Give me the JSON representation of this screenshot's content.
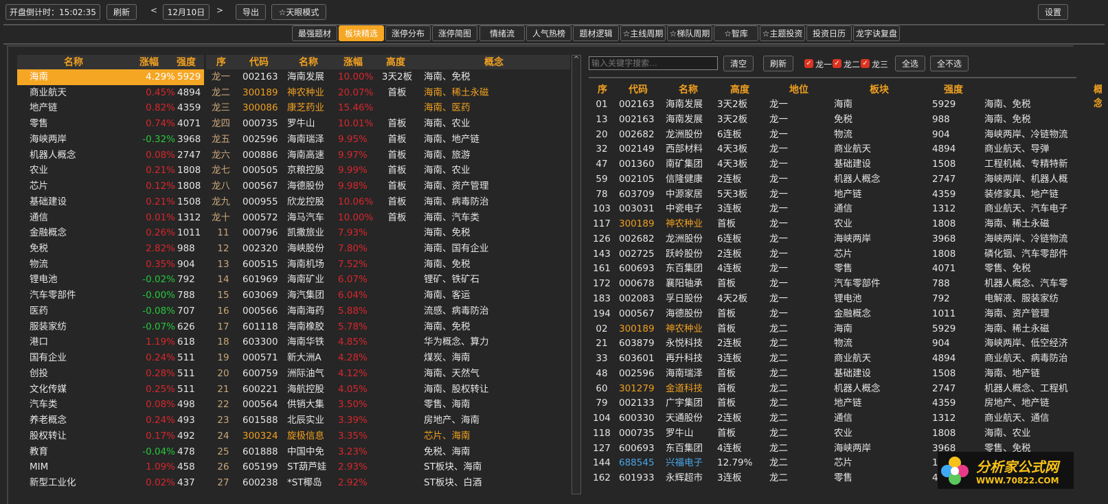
{
  "toolbar": {
    "countdown": "开盘倒计时：15:02:35",
    "refresh": "刷新",
    "prev": "<",
    "date": "12月10日",
    "next": ">",
    "export": "导出",
    "tianyan": "☆天眼模式",
    "settings": "设置"
  },
  "tabs": [
    "最强题材",
    "板块精选",
    "涨停分布",
    "涨停简图",
    "情绪流",
    "人气热榜",
    "题材逻辑",
    "☆主线周期",
    "☆梯队周期",
    "☆智库",
    "☆主题投资",
    "投资日历",
    "龙字诀复盘"
  ],
  "active_tab": "板块精选",
  "left_table": {
    "headers": [
      "名称",
      "涨幅",
      "强度"
    ],
    "rows": [
      [
        "海南",
        "4.29%",
        "5929"
      ],
      [
        "商业航天",
        "0.45%",
        "4894"
      ],
      [
        "地产链",
        "0.82%",
        "4359"
      ],
      [
        "零售",
        "0.74%",
        "4071"
      ],
      [
        "海峡两岸",
        "-0.32%",
        "3968"
      ],
      [
        "机器人概念",
        "0.08%",
        "2747"
      ],
      [
        "农业",
        "0.21%",
        "1808"
      ],
      [
        "芯片",
        "0.12%",
        "1808"
      ],
      [
        "基础建设",
        "0.21%",
        "1508"
      ],
      [
        "通信",
        "0.01%",
        "1312"
      ],
      [
        "金融概念",
        "0.26%",
        "1011"
      ],
      [
        "免税",
        "2.82%",
        "988"
      ],
      [
        "物流",
        "0.35%",
        "904"
      ],
      [
        "锂电池",
        "-0.02%",
        "792"
      ],
      [
        "汽车零部件",
        "-0.00%",
        "788"
      ],
      [
        "医药",
        "-0.08%",
        "707"
      ],
      [
        "服装家纺",
        "-0.07%",
        "626"
      ],
      [
        "港口",
        "1.19%",
        "618"
      ],
      [
        "国有企业",
        "0.24%",
        "511"
      ],
      [
        "创投",
        "0.28%",
        "511"
      ],
      [
        "文化传媒",
        "0.25%",
        "511"
      ],
      [
        "汽车类",
        "0.08%",
        "498"
      ],
      [
        "养老概念",
        "0.24%",
        "493"
      ],
      [
        "股权转让",
        "0.17%",
        "492"
      ],
      [
        "教育",
        "-0.04%",
        "478"
      ],
      [
        "MIM",
        "1.09%",
        "458"
      ],
      [
        "新型工业化",
        "0.02%",
        "437"
      ]
    ]
  },
  "mid_table": {
    "headers": [
      "序",
      "代码",
      "名称",
      "涨幅",
      "高度",
      "概念"
    ],
    "rows": [
      [
        "龙一",
        "002163",
        "海南发展",
        "10.00%",
        "3天2板",
        "海南、免税",
        0
      ],
      [
        "龙二",
        "300189",
        "神农种业",
        "20.07%",
        "首板",
        "海南、稀土永磁",
        1
      ],
      [
        "龙三",
        "300086",
        "康芝药业",
        "15.46%",
        "",
        "海南、医药",
        1
      ],
      [
        "龙四",
        "000735",
        "罗牛山",
        "10.01%",
        "首板",
        "海南、农业",
        0
      ],
      [
        "龙五",
        "002596",
        "海南瑞泽",
        "9.95%",
        "首板",
        "海南、地产链",
        0
      ],
      [
        "龙六",
        "000886",
        "海南高速",
        "9.97%",
        "首板",
        "海南、旅游",
        0
      ],
      [
        "龙七",
        "000505",
        "京粮控股",
        "9.99%",
        "首板",
        "海南、农业",
        0
      ],
      [
        "龙八",
        "000567",
        "海德股份",
        "9.98%",
        "首板",
        "海南、资产管理",
        0
      ],
      [
        "龙九",
        "000955",
        "欣龙控股",
        "10.06%",
        "首板",
        "海南、病毒防治",
        0
      ],
      [
        "龙十",
        "000572",
        "海马汽车",
        "10.00%",
        "首板",
        "海南、汽车类",
        0
      ],
      [
        "11",
        "000796",
        "凯撒旅业",
        "7.93%",
        "",
        "海南、免税",
        0
      ],
      [
        "12",
        "002320",
        "海峡股份",
        "7.80%",
        "",
        "海南、国有企业",
        0
      ],
      [
        "13",
        "600515",
        "海南机场",
        "7.52%",
        "",
        "海南、免税",
        0
      ],
      [
        "14",
        "601969",
        "海南矿业",
        "6.07%",
        "",
        "锂矿、铁矿石",
        0
      ],
      [
        "15",
        "603069",
        "海汽集团",
        "6.04%",
        "",
        "海南、客运",
        0
      ],
      [
        "16",
        "000566",
        "海南海药",
        "5.88%",
        "",
        "流感、病毒防治",
        0
      ],
      [
        "17",
        "601118",
        "海南橡胶",
        "5.78%",
        "",
        "海南、免税",
        0
      ],
      [
        "18",
        "603300",
        "海南华铁",
        "4.85%",
        "",
        "华为概念、算力",
        0
      ],
      [
        "19",
        "000571",
        "新大洲A",
        "4.28%",
        "",
        "煤炭、海南",
        0
      ],
      [
        "20",
        "600759",
        "洲际油气",
        "4.12%",
        "",
        "海南、天然气",
        0
      ],
      [
        "21",
        "600221",
        "海航控股",
        "4.05%",
        "",
        "海南、股权转让",
        0
      ],
      [
        "22",
        "000564",
        "供销大集",
        "3.50%",
        "",
        "零售、海南",
        0
      ],
      [
        "23",
        "601588",
        "北辰实业",
        "3.39%",
        "",
        "房地产、海南",
        0
      ],
      [
        "24",
        "300324",
        "旋极信息",
        "3.35%",
        "",
        "芯片、海南",
        1
      ],
      [
        "25",
        "601888",
        "中国中免",
        "3.23%",
        "",
        "免税、海南",
        0
      ],
      [
        "26",
        "605199",
        "ST葫芦娃",
        "2.93%",
        "",
        "ST板块、海南",
        0
      ],
      [
        "27",
        "600238",
        "*ST椰岛",
        "2.92%",
        "",
        "ST板块、白酒",
        0
      ]
    ]
  },
  "right_panel": {
    "search_placeholder": "输入关键字搜索…",
    "clear": "清空",
    "refresh": "刷新",
    "filters": [
      "龙一",
      "龙二",
      "龙三"
    ],
    "select_all": "全选",
    "select_none": "全不选",
    "headers": [
      "序",
      "代码",
      "名称",
      "高度",
      "地位",
      "板块",
      "强度",
      "概念"
    ],
    "rows": [
      [
        "01",
        "002163",
        "海南发展",
        "3天2板",
        "龙一",
        "海南",
        "5929",
        "海南、免税",
        0
      ],
      [
        "13",
        "002163",
        "海南发展",
        "3天2板",
        "龙一",
        "免税",
        "988",
        "海南、免税",
        0
      ],
      [
        "20",
        "002682",
        "龙洲股份",
        "6连板",
        "龙一",
        "物流",
        "904",
        "海峡两岸、冷链物流",
        0
      ],
      [
        "32",
        "002149",
        "西部材料",
        "4天3板",
        "龙一",
        "商业航天",
        "4894",
        "商业航天、导弹",
        0
      ],
      [
        "47",
        "001360",
        "南矿集团",
        "4天3板",
        "龙一",
        "基础建设",
        "1508",
        "工程机械、专精特新",
        0
      ],
      [
        "59",
        "002105",
        "信隆健康",
        "2连板",
        "龙一",
        "机器人概念",
        "2747",
        "海峡两岸、机器人概",
        0
      ],
      [
        "78",
        "603709",
        "中源家居",
        "5天3板",
        "龙一",
        "地产链",
        "4359",
        "装修家具、地产链",
        0
      ],
      [
        "103",
        "003031",
        "中瓷电子",
        "3连板",
        "龙一",
        "通信",
        "1312",
        "商业航天、汽车电子",
        0
      ],
      [
        "117",
        "300189",
        "神农种业",
        "首板",
        "龙一",
        "农业",
        "1808",
        "海南、稀土永磁",
        1
      ],
      [
        "126",
        "002682",
        "龙洲股份",
        "6连板",
        "龙一",
        "海峡两岸",
        "3968",
        "海峡两岸、冷链物流",
        0
      ],
      [
        "143",
        "002725",
        "跃岭股份",
        "2连板",
        "龙一",
        "芯片",
        "1808",
        "磷化铟、汽车零部件",
        0
      ],
      [
        "161",
        "600693",
        "东百集团",
        "4连板",
        "龙一",
        "零售",
        "4071",
        "零售、免税",
        0
      ],
      [
        "172",
        "000678",
        "襄阳轴承",
        "首板",
        "龙一",
        "汽车零部件",
        "788",
        "机器人概念、汽车零",
        0
      ],
      [
        "183",
        "002083",
        "孚日股份",
        "4天2板",
        "龙一",
        "锂电池",
        "792",
        "电解液、服装家纺",
        0
      ],
      [
        "194",
        "000567",
        "海德股份",
        "首板",
        "龙一",
        "金融概念",
        "1011",
        "海南、资产管理",
        0
      ],
      [
        "02",
        "300189",
        "神农种业",
        "首板",
        "龙二",
        "海南",
        "5929",
        "海南、稀土永磁",
        1
      ],
      [
        "21",
        "603879",
        "永悦科技",
        "2连板",
        "龙二",
        "物流",
        "904",
        "海峡两岸、低空经济",
        0
      ],
      [
        "33",
        "603601",
        "再升科技",
        "3连板",
        "龙二",
        "商业航天",
        "4894",
        "商业航天、病毒防治",
        0
      ],
      [
        "48",
        "002596",
        "海南瑞泽",
        "首板",
        "龙二",
        "基础建设",
        "1508",
        "海南、地产链",
        0
      ],
      [
        "60",
        "301279",
        "金道科技",
        "首板",
        "龙二",
        "机器人概念",
        "2747",
        "机器人概念、工程机",
        1
      ],
      [
        "79",
        "002133",
        "广宇集团",
        "首板",
        "龙二",
        "地产链",
        "4359",
        "房地产、地产链",
        0
      ],
      [
        "104",
        "600330",
        "天通股份",
        "2连板",
        "龙二",
        "通信",
        "1312",
        "商业航天、通信",
        0
      ],
      [
        "118",
        "000735",
        "罗牛山",
        "首板",
        "龙二",
        "农业",
        "1808",
        "海南、农业",
        0
      ],
      [
        "127",
        "600693",
        "东百集团",
        "4连板",
        "龙二",
        "海峡两岸",
        "3968",
        "零售、免税",
        0
      ],
      [
        "144",
        "688545",
        "兴福电子",
        "12.79%",
        "龙二",
        "芯片",
        "1",
        "",
        2
      ],
      [
        "162",
        "601933",
        "永辉超市",
        "3连板",
        "龙二",
        "零售",
        "4",
        "",
        0
      ]
    ]
  },
  "logo": {
    "text": "分析家公式网",
    "url": "WWW.70822.COM"
  },
  "colors": {
    "accent": "#f5a623",
    "up": "#d9262c",
    "down": "#25c93a",
    "highlight": "#f0a020",
    "star": "#4aa6e8"
  }
}
